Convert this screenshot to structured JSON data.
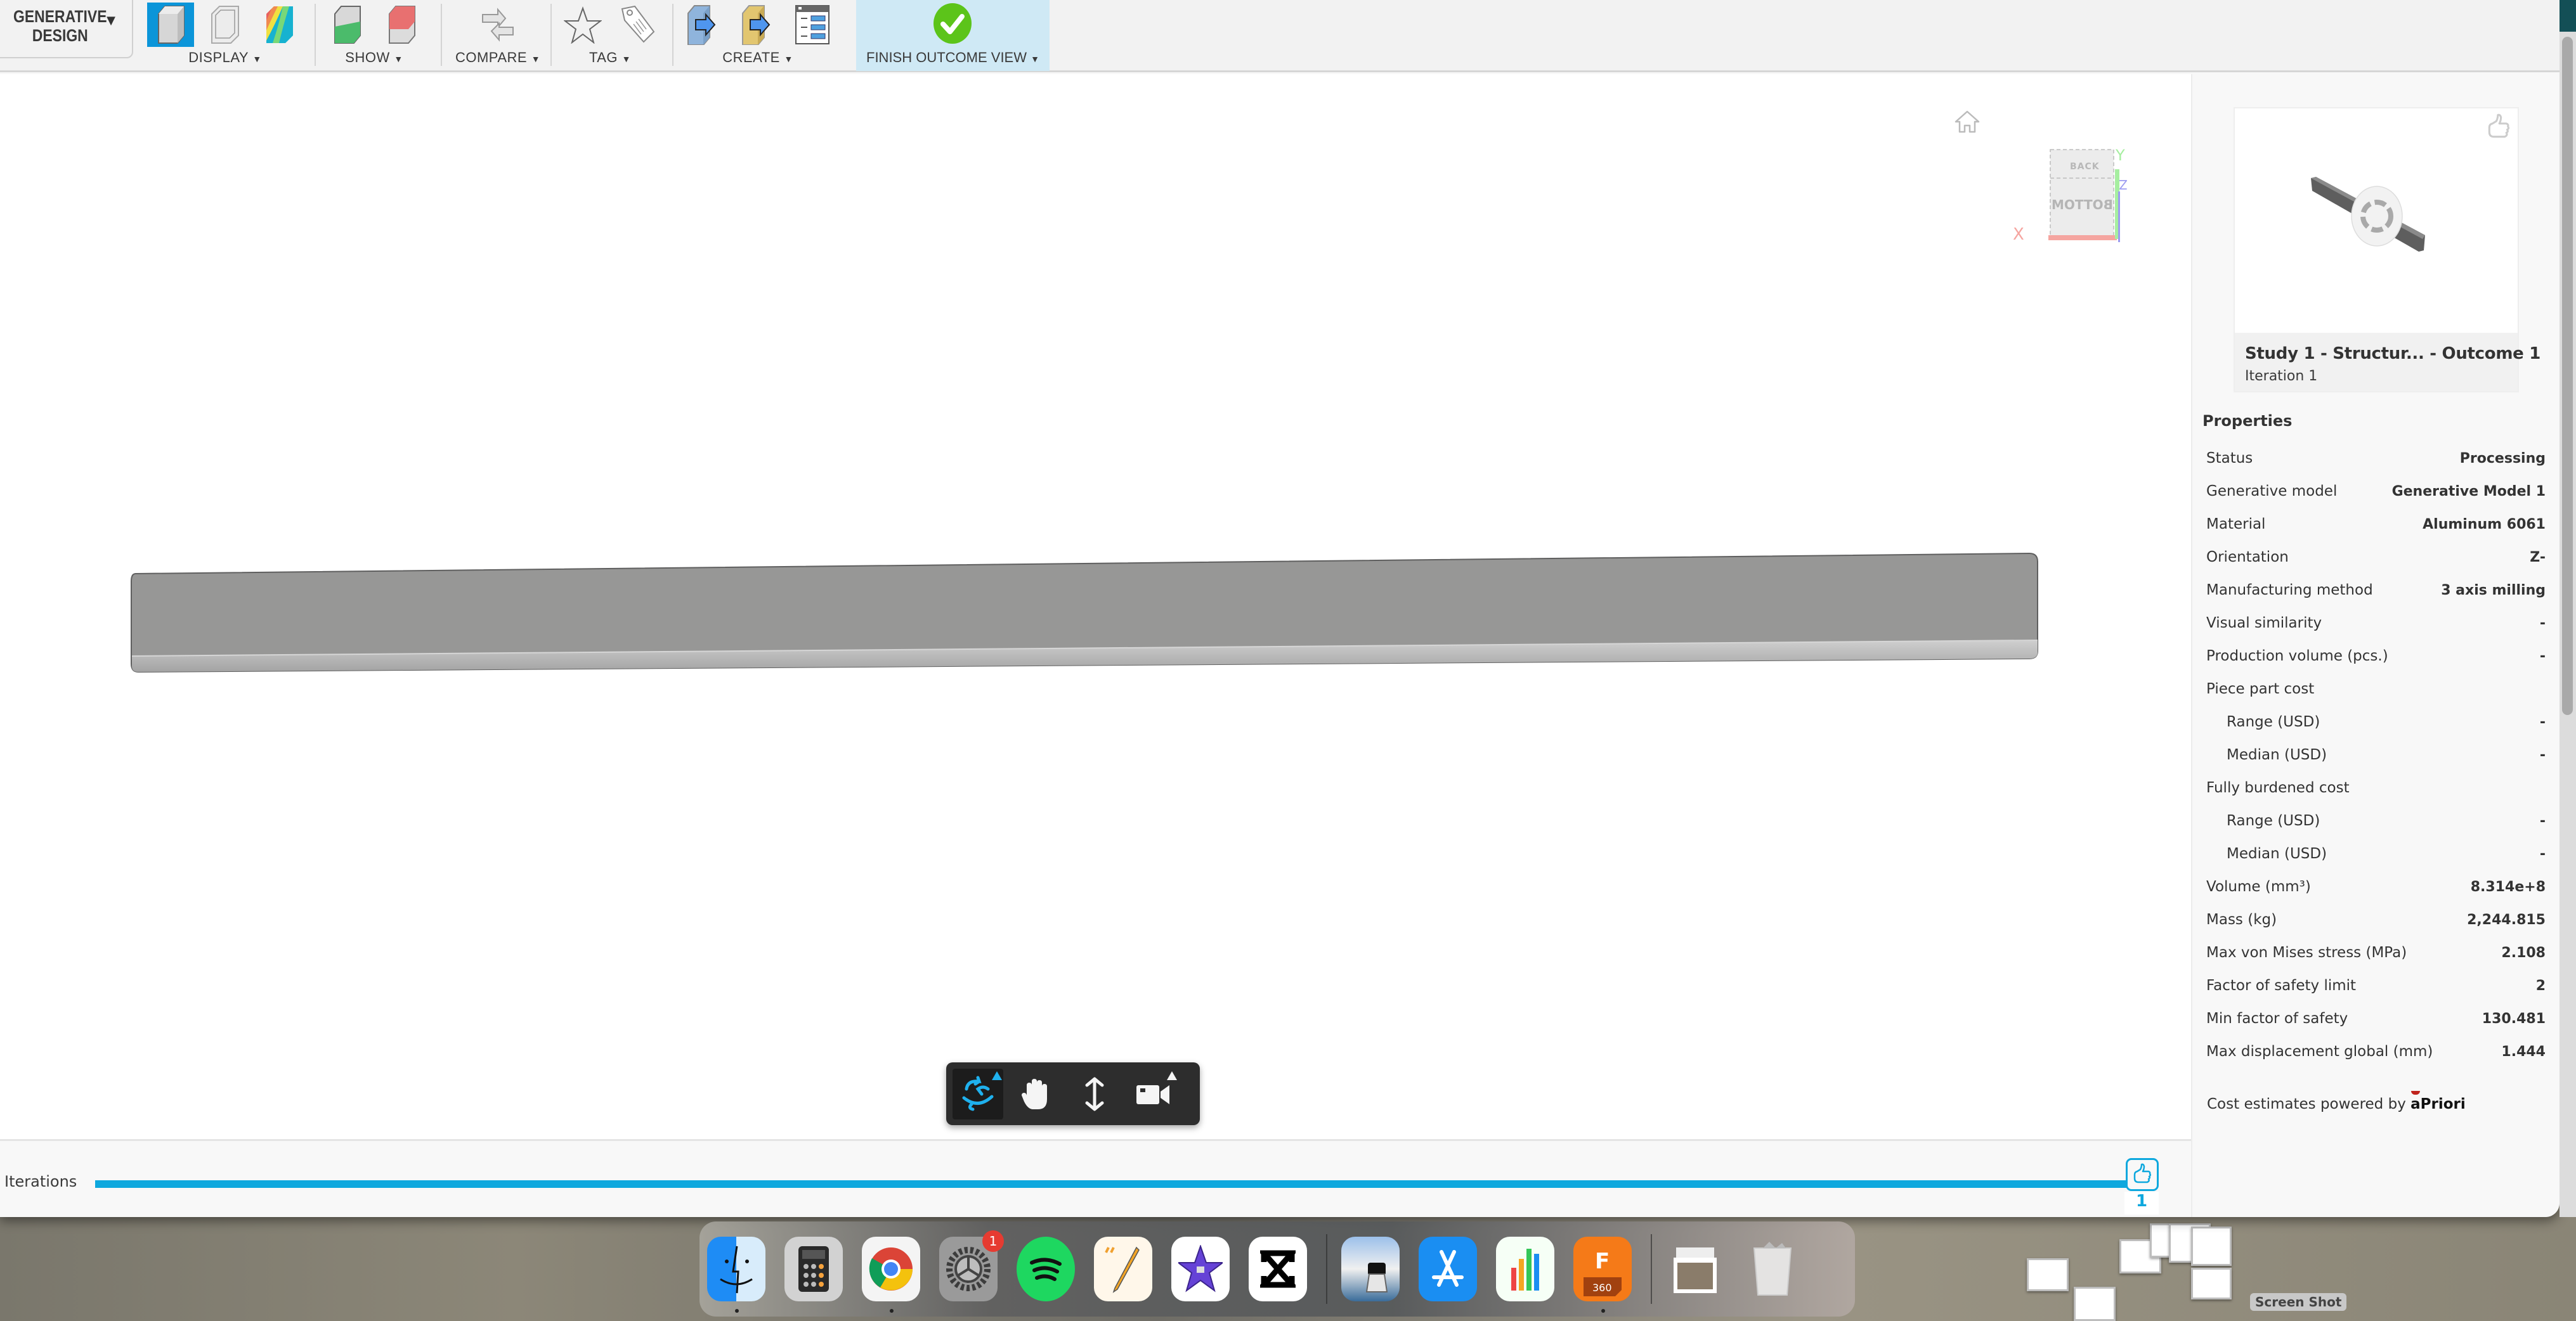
{
  "toolbar": {
    "workspace": {
      "line1": "GENERATIVE",
      "line2": "DESIGN"
    },
    "groups": [
      {
        "label": "DISPLAY",
        "icons": [
          "solid-display-icon",
          "wireframe-display-icon",
          "stress-display-icon"
        ]
      },
      {
        "label": "SHOW",
        "icons": [
          "show-preserve-icon",
          "show-obstacle-icon"
        ]
      },
      {
        "label": "COMPARE",
        "icons": [
          "compare-arrows-icon"
        ]
      },
      {
        "label": "TAG",
        "icons": [
          "star-icon",
          "tag-icon"
        ]
      },
      {
        "label": "CREATE",
        "icons": [
          "create-design-icon",
          "create-mesh-icon",
          "report-list-icon"
        ]
      }
    ],
    "finish": {
      "label": "FINISH OUTCOME VIEW"
    },
    "caret": "▾"
  },
  "viewcube": {
    "top_face": "BACK",
    "front_face": "BOTTOM",
    "axes": {
      "x": "X",
      "y": "Y",
      "z": "Z"
    }
  },
  "navbar": {
    "tools": [
      "orbit",
      "pan",
      "zoom",
      "camera"
    ]
  },
  "iterations": {
    "label": "Iterations",
    "current": "1",
    "progress": 1.0
  },
  "panel": {
    "card": {
      "title": "Study 1 - Structur... - Outcome 1",
      "subtitle": "Iteration 1"
    },
    "properties_title": "Properties",
    "properties": [
      {
        "key": "Status",
        "value": "Processing",
        "indent": false
      },
      {
        "key": "Generative model",
        "value": "Generative Model 1",
        "indent": false
      },
      {
        "key": "Material",
        "value": "Aluminum 6061",
        "indent": false
      },
      {
        "key": "Orientation",
        "value": "Z-",
        "indent": false
      },
      {
        "key": "Manufacturing method",
        "value": "3 axis milling",
        "indent": false
      },
      {
        "key": "Visual similarity",
        "value": "-",
        "indent": false
      },
      {
        "key": "Production volume (pcs.)",
        "value": "-",
        "indent": false
      },
      {
        "key": "Piece part cost",
        "value": "",
        "indent": false
      },
      {
        "key": "Range (USD)",
        "value": "-",
        "indent": true
      },
      {
        "key": "Median (USD)",
        "value": "-",
        "indent": true
      },
      {
        "key": "Fully burdened cost",
        "value": "",
        "indent": false
      },
      {
        "key": "Range (USD)",
        "value": "-",
        "indent": true
      },
      {
        "key": "Median (USD)",
        "value": "-",
        "indent": true
      },
      {
        "key": "Volume (mm³)",
        "value": "8.314e+8",
        "indent": false
      },
      {
        "key": "Mass (kg)",
        "value": "2,244.815",
        "indent": false
      },
      {
        "key": "Max von Mises stress (MPa)",
        "value": "2.108",
        "indent": false
      },
      {
        "key": "Factor of safety limit",
        "value": "2",
        "indent": false
      },
      {
        "key": "Min factor of safety",
        "value": "130.481",
        "indent": false
      },
      {
        "key": "Max displacement global (mm)",
        "value": "1.444",
        "indent": false
      }
    ],
    "powered_by": "Cost estimates powered by",
    "powered_brand": "aPriori"
  },
  "dock": {
    "apps": [
      {
        "name": "Finder",
        "running": true
      },
      {
        "name": "Calculator",
        "running": false
      },
      {
        "name": "Google Chrome",
        "running": true
      },
      {
        "name": "System Preferences",
        "running": false,
        "badge": "1"
      },
      {
        "name": "Spotify",
        "running": false
      },
      {
        "name": "Pages",
        "running": false
      },
      {
        "name": "iMovie",
        "running": false
      },
      {
        "name": "CapCut",
        "running": false
      },
      {
        "name": "Preview",
        "running": false
      },
      {
        "name": "App Store",
        "running": false
      },
      {
        "name": "Numbers",
        "running": false
      },
      {
        "name": "Autodesk Fusion 360",
        "running": true,
        "label": "360"
      },
      {
        "name": "Downloads stack",
        "running": false
      },
      {
        "name": "Trash",
        "running": false
      }
    ]
  },
  "desktop": {
    "screenshot_label": "Screen Shot"
  },
  "colors": {
    "accent": "#0ea8de",
    "active_tool": "#0b95d9",
    "finish_bg": "#cfe9f5",
    "finish_check": "#5cc41a"
  }
}
